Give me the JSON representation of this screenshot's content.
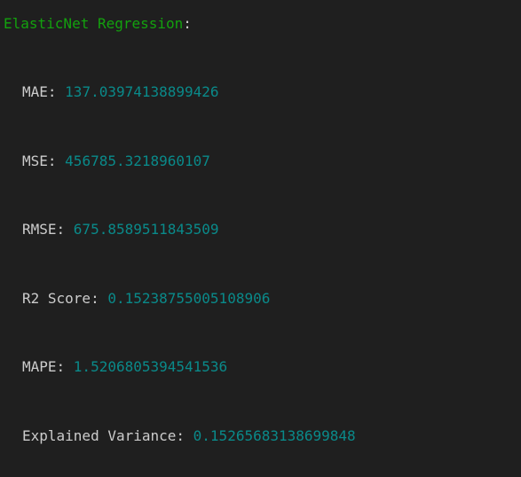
{
  "colors": {
    "background": "#1f1f1f",
    "title": "#13a10e",
    "label": "#cccccc",
    "value": "#0a8a8a"
  },
  "header": {
    "title": "ElasticNet Regression",
    "title_suffix": ":"
  },
  "metrics": [
    {
      "label": "MAE",
      "sep": ": ",
      "value": "137.03974138899426"
    },
    {
      "label": "MSE",
      "sep": ": ",
      "value": "456785.3218960107"
    },
    {
      "label": "RMSE",
      "sep": ": ",
      "value": "675.8589511843509"
    },
    {
      "label": "R2 Score",
      "sep": ": ",
      "value": "0.15238755005108906"
    },
    {
      "label": "MAPE",
      "sep": ": ",
      "value": "1.5206805394541536"
    },
    {
      "label": "Explained Variance",
      "sep": ": ",
      "value": "0.15265683138699848"
    }
  ]
}
